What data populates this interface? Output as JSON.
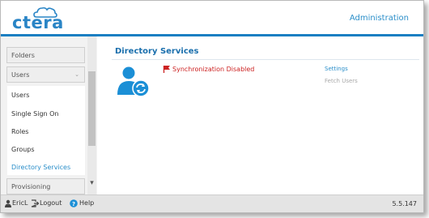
{
  "header": {
    "logo_text": "ctera",
    "title": "Administration"
  },
  "sidebar": {
    "groups": {
      "folders": "Folders",
      "users": "Users",
      "provisioning": "Provisioning"
    },
    "items": [
      {
        "label": "Users"
      },
      {
        "label": "Single Sign On"
      },
      {
        "label": "Roles"
      },
      {
        "label": "Groups"
      },
      {
        "label": "Directory Services",
        "active": true
      }
    ]
  },
  "main": {
    "title": "Directory Services",
    "status": "Synchronization Disabled",
    "links": {
      "settings": "Settings",
      "fetch_users": "Fetch Users"
    }
  },
  "footer": {
    "user": "EricL",
    "logout": "Logout",
    "help": "Help",
    "version": "5.5.147"
  },
  "colors": {
    "brand": "#2a85c6",
    "accent_rule": "#1b7fc2",
    "status_error": "#cc2222",
    "link": "#2a8ec9"
  },
  "icons": [
    "cloud-logo-icon",
    "chevron-down-icon",
    "user-sync-icon",
    "red-flag-icon",
    "user-icon",
    "logout-icon",
    "help-icon"
  ]
}
